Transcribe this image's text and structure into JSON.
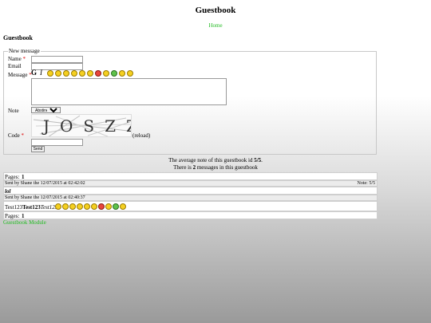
{
  "header": {
    "site_title": "Guestbook",
    "home_link": "Home"
  },
  "page": {
    "heading": "Guestbook"
  },
  "form": {
    "legend": "New message",
    "name_label": "Name",
    "email_label": "Email",
    "message_label": "Message",
    "required_mark": "*",
    "bold_button": "G",
    "italic_button": "I",
    "note_label": "Note",
    "note_selected": "Abstinence",
    "code_label": "Code",
    "captcha_text": "JOSZZ",
    "reload_label": "(reload)",
    "send_label": "Send"
  },
  "stats": {
    "average_prefix": "The average note of this guestbook id ",
    "average_value": "5/5",
    "average_suffix": ".",
    "count_prefix": "There is ",
    "count_value": "2",
    "count_suffix": " messages in this guestbook"
  },
  "pagination": {
    "label": "Pages:",
    "current": "1"
  },
  "messages": [
    {
      "meta": "Sent by Shane the 12/07/2015 at 02:42:02",
      "note": "Note: 5/5",
      "body": "lol"
    },
    {
      "meta": "Sent by Shane the 12/07/2015 at 02:40:37",
      "body_plain": "Test123",
      "body_bold": "Test123",
      "body_italic": "Test123"
    }
  ],
  "footer": {
    "module_link": "Guestbook Module"
  },
  "colors": {
    "link": "#22bb22",
    "required": "#dd0000"
  }
}
